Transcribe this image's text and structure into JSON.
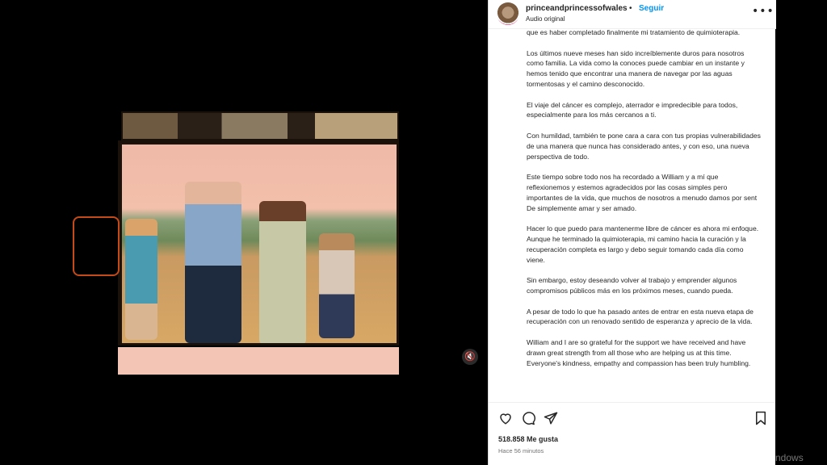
{
  "post": {
    "username": "princeandprincessofwales",
    "separator": "•",
    "follow_label": "Seguir",
    "audio_label": "Audio original",
    "more_label": "•••",
    "caption_paragraphs": [
      "que es haber completado finalmente mi tratamiento de quimioterapia.",
      "Los últimos nueve meses han sido increíblemente duros para nosotros como familia. La vida como la conoces puede cambiar en un instante y hemos tenido que encontrar una manera de navegar por las aguas tormentosas y el camino desconocido.",
      "El viaje del cáncer es complejo, aterrador e impredecible para todos, especialmente para los más cercanos a ti.",
      "Con humildad, también te pone cara a cara con tus propias vulnerabilidades de una manera que nunca has considerado antes, y con eso, una nueva perspectiva de todo.",
      "Este tiempo sobre todo nos ha recordado a William y a mí que reflexionemos y estemos agradecidos por las cosas simples pero importantes de la vida, que muchos de nosotros a menudo damos por sent De simplemente amar y ser amado.",
      "Hacer lo que puedo para mantenerme libre de cáncer es ahora mi enfoque. Aunque he terminado la quimioterapia, mi camino hacia la curación y la recuperación completa es largo y debo seguir tomando cada día como viene.",
      "Sin embargo, estoy deseando volver al trabajo y emprender algunos compromisos públicos más en los próximos meses, cuando pueda.",
      "A pesar de todo lo que ha pasado antes de entrar en esta nueva etapa de recuperación con un renovado sentido de esperanza y aprecio de la vida.",
      "William and I are so grateful for the support we have received and have drawn great strength from all those who are helping us at this time. Everyone's kindness, empathy and compassion has been truly humbling."
    ],
    "likes": "518.858 Me gusta",
    "time_ago": "Hace 56 minutos"
  },
  "icons": {
    "like": "heart-icon",
    "comment": "comment-icon",
    "share": "share-icon",
    "save": "bookmark-icon",
    "mute": "speaker-muted-icon"
  },
  "mute_glyph": "🔇",
  "watermark": "Activar Windows",
  "colors": {
    "link": "#0095f6",
    "text": "#262626",
    "muted": "#737373"
  }
}
